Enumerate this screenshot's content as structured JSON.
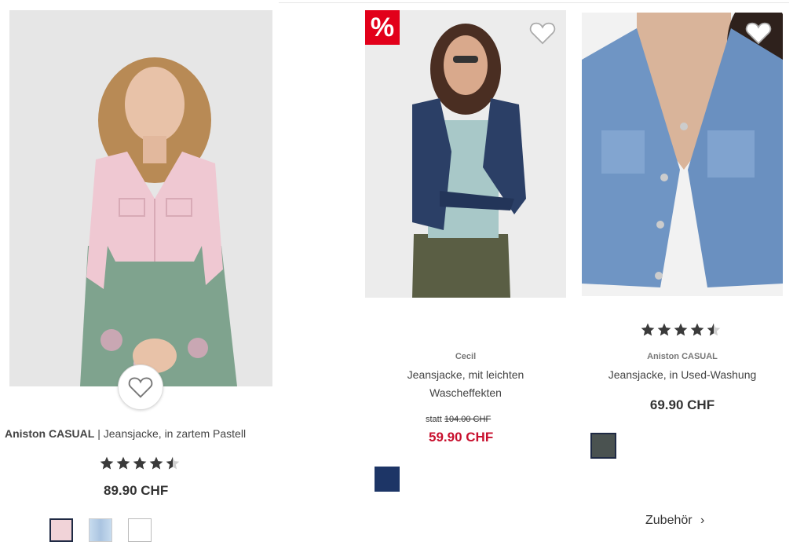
{
  "products": [
    {
      "brand": "Aniston CASUAL",
      "separator": " | ",
      "name": "Jeansjacke, in zartem Pastell",
      "rating": 4.5,
      "price": "89.90 CHF",
      "swatches": [
        "#f1d3d8",
        "#bfd5ea",
        "#ffffff"
      ],
      "selected_swatch": 0
    },
    {
      "badge": "%",
      "brand": "Cecil",
      "name_line1": "Jeansjacke, mit leichten",
      "name_line2": "Wascheffekten",
      "old_price_prefix": "statt",
      "old_price": "104.00 CHF",
      "price": "59.90 CHF",
      "swatches": [
        "#1d3566"
      ]
    },
    {
      "brand": "Aniston CASUAL",
      "name": "Jeansjacke, in Used-Washung",
      "rating": 4.5,
      "price": "69.90 CHF",
      "swatches": [
        "#4a5250"
      ],
      "selected_swatch": 0
    }
  ],
  "accessory_link": {
    "label": "Zubehör",
    "icon": "chevron-right-icon",
    "glyph": "›"
  },
  "colors": {
    "sale": "#c8102e",
    "badge": "#e2001a"
  }
}
